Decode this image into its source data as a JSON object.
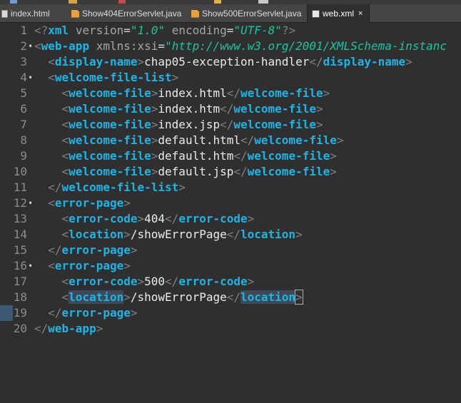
{
  "tabs": [
    {
      "label": "index.html",
      "icon": "html-file-icon"
    },
    {
      "label": "Show404ErrorServlet.java",
      "icon": "java-file-icon"
    },
    {
      "label": "Show500ErrorServlet.java",
      "icon": "java-file-icon"
    },
    {
      "label": "web.xml",
      "icon": "xml-file-icon",
      "active": true,
      "close": "×"
    }
  ],
  "editor": {
    "current_line": 18,
    "lines": [
      {
        "n": "1",
        "fold": "",
        "tokens": [
          [
            "pi",
            "<?"
          ],
          [
            "tag",
            "xml"
          ],
          [
            "t",
            " "
          ],
          [
            "attr",
            "version"
          ],
          [
            "eq",
            "="
          ],
          [
            "str",
            "\"1.0\""
          ],
          [
            "t",
            " "
          ],
          [
            "attr",
            "encoding"
          ],
          [
            "eq",
            "="
          ],
          [
            "str",
            "\"UTF-8\""
          ],
          [
            "pi",
            "?>"
          ]
        ]
      },
      {
        "n": "2",
        "fold": "•",
        "tokens": [
          [
            "br",
            "<"
          ],
          [
            "tag",
            "web-app"
          ],
          [
            "t",
            " "
          ],
          [
            "attr",
            "xmlns:xsi"
          ],
          [
            "eq",
            "="
          ],
          [
            "str",
            "\"http://www.w3.org/2001/XMLSchema-instanc"
          ]
        ]
      },
      {
        "n": "3",
        "fold": "",
        "tokens": [
          [
            "t",
            "  "
          ],
          [
            "br",
            "<"
          ],
          [
            "tag",
            "display-name"
          ],
          [
            "br",
            ">"
          ],
          [
            "txt",
            "chap05-exception-handler"
          ],
          [
            "br",
            "</"
          ],
          [
            "tag",
            "display-name"
          ],
          [
            "br",
            ">"
          ]
        ]
      },
      {
        "n": "4",
        "fold": "•",
        "tokens": [
          [
            "t",
            "  "
          ],
          [
            "br",
            "<"
          ],
          [
            "tag",
            "welcome-file-list"
          ],
          [
            "br",
            ">"
          ]
        ]
      },
      {
        "n": "5",
        "fold": "",
        "tokens": [
          [
            "t",
            "    "
          ],
          [
            "br",
            "<"
          ],
          [
            "tag",
            "welcome-file"
          ],
          [
            "br",
            ">"
          ],
          [
            "txt",
            "index.html"
          ],
          [
            "br",
            "</"
          ],
          [
            "tag",
            "welcome-file"
          ],
          [
            "br",
            ">"
          ]
        ]
      },
      {
        "n": "6",
        "fold": "",
        "tokens": [
          [
            "t",
            "    "
          ],
          [
            "br",
            "<"
          ],
          [
            "tag",
            "welcome-file"
          ],
          [
            "br",
            ">"
          ],
          [
            "txt",
            "index.htm"
          ],
          [
            "br",
            "</"
          ],
          [
            "tag",
            "welcome-file"
          ],
          [
            "br",
            ">"
          ]
        ]
      },
      {
        "n": "7",
        "fold": "",
        "tokens": [
          [
            "t",
            "    "
          ],
          [
            "br",
            "<"
          ],
          [
            "tag",
            "welcome-file"
          ],
          [
            "br",
            ">"
          ],
          [
            "txt",
            "index.jsp"
          ],
          [
            "br",
            "</"
          ],
          [
            "tag",
            "welcome-file"
          ],
          [
            "br",
            ">"
          ]
        ]
      },
      {
        "n": "8",
        "fold": "",
        "tokens": [
          [
            "t",
            "    "
          ],
          [
            "br",
            "<"
          ],
          [
            "tag",
            "welcome-file"
          ],
          [
            "br",
            ">"
          ],
          [
            "txt",
            "default.html"
          ],
          [
            "br",
            "</"
          ],
          [
            "tag",
            "welcome-file"
          ],
          [
            "br",
            ">"
          ]
        ]
      },
      {
        "n": "9",
        "fold": "",
        "tokens": [
          [
            "t",
            "    "
          ],
          [
            "br",
            "<"
          ],
          [
            "tag",
            "welcome-file"
          ],
          [
            "br",
            ">"
          ],
          [
            "txt",
            "default.htm"
          ],
          [
            "br",
            "</"
          ],
          [
            "tag",
            "welcome-file"
          ],
          [
            "br",
            ">"
          ]
        ]
      },
      {
        "n": "10",
        "fold": "",
        "tokens": [
          [
            "t",
            "    "
          ],
          [
            "br",
            "<"
          ],
          [
            "tag",
            "welcome-file"
          ],
          [
            "br",
            ">"
          ],
          [
            "txt",
            "default.jsp"
          ],
          [
            "br",
            "</"
          ],
          [
            "tag",
            "welcome-file"
          ],
          [
            "br",
            ">"
          ]
        ]
      },
      {
        "n": "11",
        "fold": "",
        "tokens": [
          [
            "t",
            "  "
          ],
          [
            "br",
            "</"
          ],
          [
            "tag",
            "welcome-file-list"
          ],
          [
            "br",
            ">"
          ]
        ]
      },
      {
        "n": "12",
        "fold": "•",
        "tokens": [
          [
            "t",
            "  "
          ],
          [
            "br",
            "<"
          ],
          [
            "tag",
            "error-page"
          ],
          [
            "br",
            ">"
          ]
        ]
      },
      {
        "n": "13",
        "fold": "",
        "tokens": [
          [
            "t",
            "    "
          ],
          [
            "br",
            "<"
          ],
          [
            "tag",
            "error-code"
          ],
          [
            "br",
            ">"
          ],
          [
            "txt",
            "404"
          ],
          [
            "br",
            "</"
          ],
          [
            "tag",
            "error-code"
          ],
          [
            "br",
            ">"
          ]
        ]
      },
      {
        "n": "14",
        "fold": "",
        "tokens": [
          [
            "t",
            "    "
          ],
          [
            "br",
            "<"
          ],
          [
            "tag",
            "location"
          ],
          [
            "br",
            ">"
          ],
          [
            "txt",
            "/showErrorPage"
          ],
          [
            "br",
            "</"
          ],
          [
            "tag",
            "location"
          ],
          [
            "br",
            ">"
          ]
        ]
      },
      {
        "n": "15",
        "fold": "",
        "tokens": [
          [
            "t",
            "  "
          ],
          [
            "br",
            "</"
          ],
          [
            "tag",
            "error-page"
          ],
          [
            "br",
            ">"
          ]
        ]
      },
      {
        "n": "16",
        "fold": "•",
        "tokens": [
          [
            "t",
            "  "
          ],
          [
            "br",
            "<"
          ],
          [
            "tag",
            "error-page"
          ],
          [
            "br",
            ">"
          ]
        ]
      },
      {
        "n": "17",
        "fold": "",
        "tokens": [
          [
            "t",
            "    "
          ],
          [
            "br",
            "<"
          ],
          [
            "tag",
            "error-code"
          ],
          [
            "br",
            ">"
          ],
          [
            "txt",
            "500"
          ],
          [
            "br",
            "</"
          ],
          [
            "tag",
            "error-code"
          ],
          [
            "br",
            ">"
          ]
        ]
      },
      {
        "n": "18",
        "fold": "",
        "tokens": [
          [
            "t",
            "    "
          ],
          [
            "br",
            "<"
          ],
          [
            "tag-hl",
            "location"
          ],
          [
            "br",
            ">"
          ],
          [
            "txt",
            "/showErrorPage"
          ],
          [
            "br",
            "</"
          ],
          [
            "tag-hl",
            "location"
          ],
          [
            "br-box",
            ">"
          ]
        ]
      },
      {
        "n": "19",
        "fold": "",
        "tokens": [
          [
            "t",
            "  "
          ],
          [
            "br",
            "</"
          ],
          [
            "tag",
            "error-page"
          ],
          [
            "br",
            ">"
          ]
        ]
      },
      {
        "n": "20",
        "fold": "",
        "tokens": [
          [
            "br",
            "</"
          ],
          [
            "tag",
            "web-app"
          ],
          [
            "br",
            ">"
          ]
        ]
      }
    ]
  },
  "colors": {
    "background": "#2f2f2f",
    "tag": "#1eb4e6",
    "string": "#17c6a3",
    "text": "#ebebeb",
    "bracket": "#808080"
  }
}
